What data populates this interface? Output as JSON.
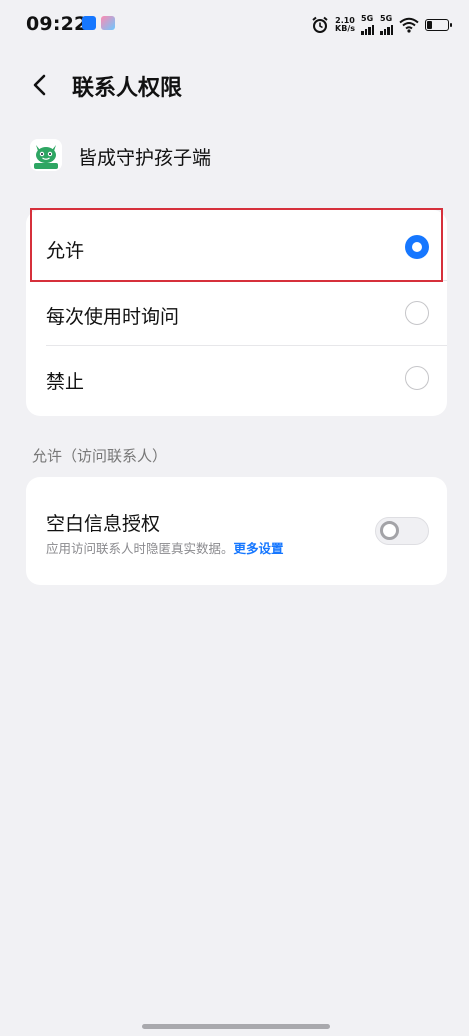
{
  "status_bar": {
    "time": "09:22",
    "speed_value": "2.10",
    "speed_unit": "KB/s",
    "network_1": "5G",
    "network_2": "5G"
  },
  "header": {
    "title": "联系人权限"
  },
  "app": {
    "name": "皆成守护孩子端",
    "icon_label": "皆成孩子"
  },
  "options": [
    {
      "label": "允许",
      "selected": true
    },
    {
      "label": "每次使用时询问",
      "selected": false
    },
    {
      "label": "禁止",
      "selected": false
    }
  ],
  "section_label": "允许（访问联系人）",
  "privacy": {
    "title": "空白信息授权",
    "description": "应用访问联系人时隐匿真实数据。",
    "link": "更多设置",
    "enabled": false
  },
  "colors": {
    "accent": "#1677ff",
    "highlight_border": "#d6303b",
    "background": "#f1f1f4"
  }
}
